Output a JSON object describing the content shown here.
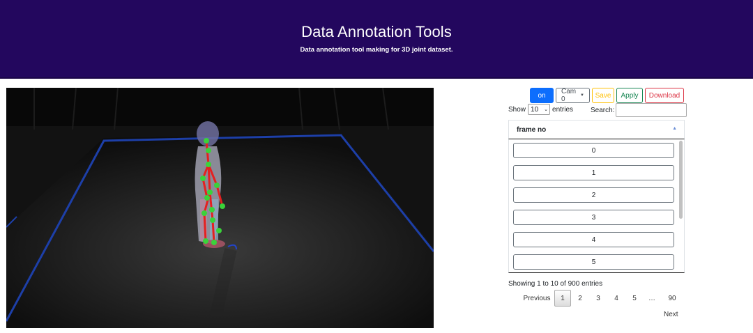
{
  "header": {
    "title": "Data Annotation Tools",
    "subtitle": "Data annotation tool making for 3D joint dataset."
  },
  "viewer": {
    "description_icon": "3d-point-cloud-view"
  },
  "toolbar": {
    "on_label": "on",
    "cam_label": "Cam 0",
    "save_label": "Save",
    "apply_label": "Apply",
    "download_label": "Download"
  },
  "table_controls": {
    "show_label": "Show",
    "entries_value": "10",
    "entries_label": "entries",
    "search_label": "Search:",
    "search_value": ""
  },
  "table": {
    "column_header": "frame no",
    "rows": [
      "0",
      "1",
      "2",
      "3",
      "4",
      "5"
    ]
  },
  "info_text": "Showing 1 to 10 of 900 entries",
  "pagination": {
    "previous": "Previous",
    "pages": [
      "1",
      "2",
      "3",
      "4",
      "5",
      "…",
      "90"
    ],
    "active_page": "1",
    "next": "Next"
  },
  "colors": {
    "header_bg": "#23075e",
    "primary": "#0d6efd",
    "warning": "#ffc107",
    "success": "#198754",
    "danger": "#dc3545"
  }
}
